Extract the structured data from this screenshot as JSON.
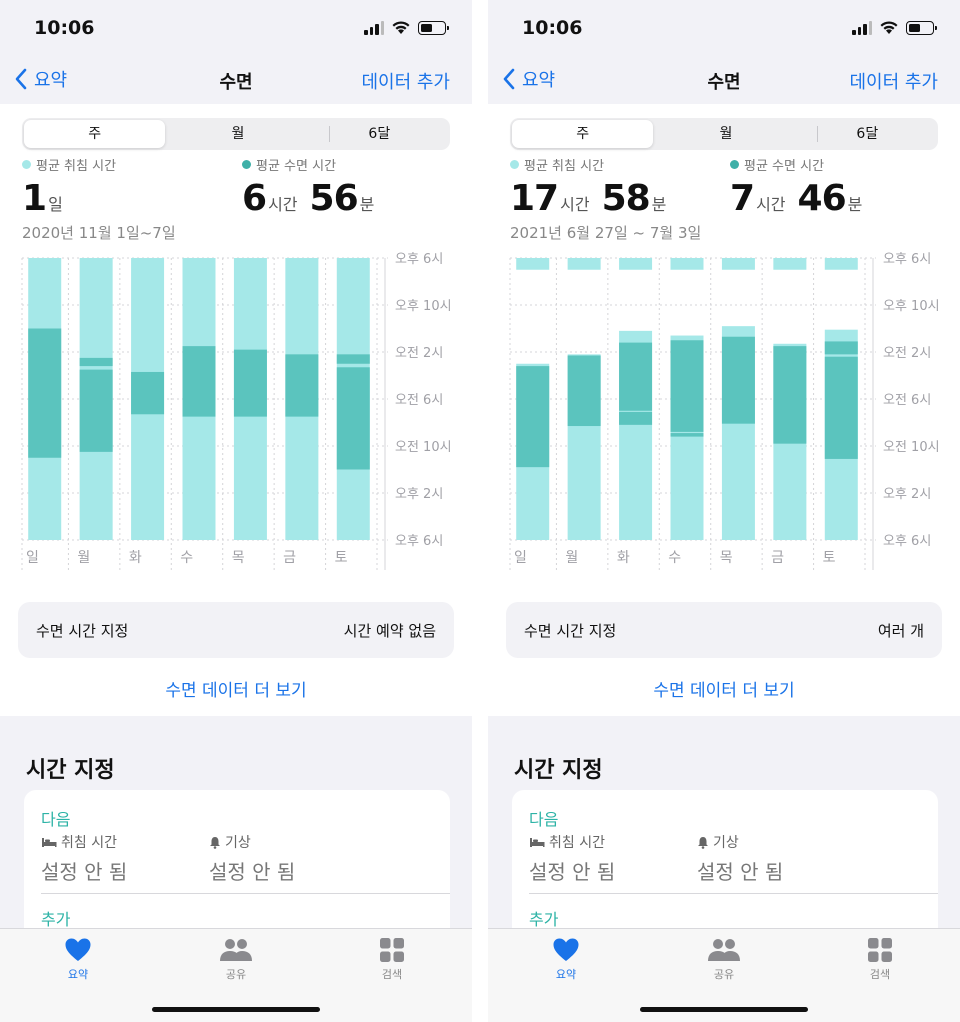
{
  "colors": {
    "accent": "#1a73e8",
    "in_bed": "#a5e8e8",
    "asleep": "#5bc4be",
    "section_teal": "#2db3a6"
  },
  "screens": [
    {
      "status": {
        "time": "10:06"
      },
      "nav": {
        "back_label": "요약",
        "title": "수면",
        "action_label": "데이터 추가"
      },
      "segments": [
        "주",
        "월",
        "6달"
      ],
      "avg_in_bed": {
        "label": "평균 취침 시간",
        "parts": [
          {
            "num": "1",
            "unit": "일"
          }
        ]
      },
      "avg_asleep": {
        "label": "평균 수면 시간",
        "parts": [
          {
            "num": "6",
            "unit": "시간"
          },
          {
            "num": "56",
            "unit": "분"
          }
        ]
      },
      "date_range": "2020년 11월 1일~7일",
      "schedule": {
        "label": "수면 시간 지정",
        "value": "시간 예약 없음"
      },
      "more_link": "수면 데이터 더 보기",
      "section_title": "시간 지정",
      "card": {
        "next_label": "다음",
        "bedtime": {
          "label": "취침 시간",
          "value": "설정 안 됨"
        },
        "wake": {
          "label": "기상",
          "value": "설정 안 됨"
        },
        "add_label": "추가"
      },
      "tabs": [
        {
          "label": "요약",
          "icon": "heart-icon"
        },
        {
          "label": "공유",
          "icon": "people-icon"
        },
        {
          "label": "검색",
          "icon": "grid-icon"
        }
      ],
      "chart_data": {
        "type": "bar",
        "categories": [
          "일",
          "월",
          "화",
          "수",
          "목",
          "금",
          "토"
        ],
        "y_ticks": [
          "오후 6시",
          "오후 10시",
          "오전 2시",
          "오전 6시",
          "오전 10시",
          "오후 2시",
          "오후 6시"
        ],
        "y_unit": "hours since 18:00",
        "ylim": [
          0,
          24
        ],
        "series": [
          {
            "segments": [
              [
                0,
                24
              ],
              [
                0,
                24
              ],
              [
                0,
                24
              ],
              [
                0,
                24
              ],
              [
                0,
                24
              ],
              [
                0,
                24
              ],
              [
                0,
                24
              ]
            ]
          },
          {
            "segments": [
              [
                6,
                17
              ],
              [
                8.5,
                9.2
              ],
              [
                9.5,
                16.5
              ],
              [
                9.7,
                13.3
              ],
              [
                7.5,
                13.5
              ],
              [
                7.8,
                13.5
              ],
              [
                8.2,
                13.5
              ],
              [
                8.2,
                9.0
              ],
              [
                9.3,
                18
              ]
            ]
          }
        ],
        "asleep_by_day": [
          [
            [
              6,
              17
            ]
          ],
          [
            [
              8.5,
              9.2
            ],
            [
              9.5,
              16.5
            ]
          ],
          [
            [
              9.7,
              13.3
            ]
          ],
          [
            [
              7.5,
              13.5
            ]
          ],
          [
            [
              7.8,
              13.5
            ]
          ],
          [
            [
              8.2,
              13.5
            ]
          ],
          [
            [
              8.2,
              9.0
            ],
            [
              9.3,
              18
            ]
          ]
        ],
        "in_bed_by_day": [
          [
            [
              0,
              24
            ]
          ],
          [
            [
              0,
              24
            ]
          ],
          [
            [
              0,
              24
            ]
          ],
          [
            [
              0,
              24
            ]
          ],
          [
            [
              0,
              24
            ]
          ],
          [
            [
              0,
              24
            ]
          ],
          [
            [
              0,
              24
            ]
          ]
        ]
      }
    },
    {
      "status": {
        "time": "10:06"
      },
      "nav": {
        "back_label": "요약",
        "title": "수면",
        "action_label": "데이터 추가"
      },
      "segments": [
        "주",
        "월",
        "6달"
      ],
      "avg_in_bed": {
        "label": "평균 취침 시간",
        "parts": [
          {
            "num": "17",
            "unit": "시간"
          },
          {
            "num": "58",
            "unit": "분"
          }
        ]
      },
      "avg_asleep": {
        "label": "평균 수면 시간",
        "parts": [
          {
            "num": "7",
            "unit": "시간"
          },
          {
            "num": "46",
            "unit": "분"
          }
        ]
      },
      "date_range": "2021년 6월 27일 ~ 7월 3일",
      "schedule": {
        "label": "수면 시간 지정",
        "value": "여러 개"
      },
      "more_link": "수면 데이터 더 보기",
      "section_title": "시간 지정",
      "card": {
        "next_label": "다음",
        "bedtime": {
          "label": "취침 시간",
          "value": "설정 안 됨"
        },
        "wake": {
          "label": "기상",
          "value": "설정 안 됨"
        },
        "add_label": "추가"
      },
      "tabs": [
        {
          "label": "요약",
          "icon": "heart-icon"
        },
        {
          "label": "공유",
          "icon": "people-icon"
        },
        {
          "label": "검색",
          "icon": "grid-icon"
        }
      ],
      "chart_data": {
        "type": "bar",
        "categories": [
          "일",
          "월",
          "화",
          "수",
          "목",
          "금",
          "토"
        ],
        "y_ticks": [
          "오후 6시",
          "오후 10시",
          "오전 2시",
          "오전 6시",
          "오전 10시",
          "오후 2시",
          "오후 6시"
        ],
        "y_unit": "hours since 18:00",
        "ylim": [
          0,
          24
        ],
        "in_bed_by_day": [
          [
            [
              0,
              1
            ],
            [
              9,
              24
            ]
          ],
          [
            [
              0,
              1
            ],
            [
              8.2,
              24
            ]
          ],
          [
            [
              0,
              1
            ],
            [
              6.2,
              24
            ]
          ],
          [
            [
              0,
              1
            ],
            [
              6.6,
              24
            ]
          ],
          [
            [
              0,
              1
            ],
            [
              5.8,
              24
            ]
          ],
          [
            [
              0,
              1
            ],
            [
              7.3,
              24
            ]
          ],
          [
            [
              0,
              1
            ],
            [
              6.1,
              24
            ]
          ]
        ],
        "asleep_by_day": [
          [
            [
              9.2,
              17.8
            ]
          ],
          [
            [
              8.3,
              14.3
            ]
          ],
          [
            [
              7.2,
              13.0
            ],
            [
              13.1,
              14.2
            ]
          ],
          [
            [
              7.0,
              14.8
            ],
            [
              14.9,
              15.2
            ]
          ],
          [
            [
              6.7,
              14.1
            ]
          ],
          [
            [
              7.5,
              15.8
            ]
          ],
          [
            [
              7.1,
              8.2
            ],
            [
              8.4,
              17.1
            ]
          ]
        ]
      }
    }
  ]
}
